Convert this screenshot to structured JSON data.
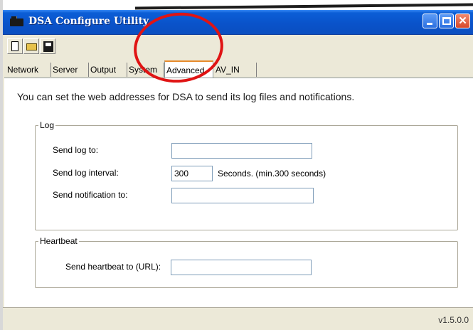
{
  "window": {
    "title": "DSA Configure Utility"
  },
  "toolbar": {
    "items": [
      "new-icon",
      "open-icon",
      "save-icon"
    ]
  },
  "tabs": [
    "Network",
    "Server",
    "Output",
    "System",
    "Advanced",
    "AV_IN"
  ],
  "active_tab": "Advanced",
  "intro": "You can set the web addresses for DSA to send its log files and notifications.",
  "log": {
    "legend": "Log",
    "send_log_to_label": "Send log to:",
    "send_log_to_value": "",
    "interval_label": "Send log interval:",
    "interval_value": "300",
    "interval_hint": "Seconds. (min.300 seconds)",
    "notification_label": "Send notification to:",
    "notification_value": ""
  },
  "heartbeat": {
    "legend": "Heartbeat",
    "url_label": "Send heartbeat to (URL):",
    "url_value": ""
  },
  "status": {
    "version": "v1.5.0.0"
  },
  "annotation": {
    "color": "#e01414"
  }
}
